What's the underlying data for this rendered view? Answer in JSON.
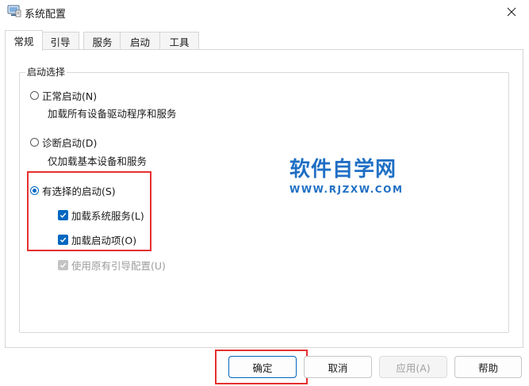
{
  "window": {
    "title": "系统配置",
    "icon": "msconfig-icon"
  },
  "tabs": [
    {
      "label": "常规",
      "active": true
    },
    {
      "label": "引导",
      "active": false
    },
    {
      "label": "服务",
      "active": false
    },
    {
      "label": "启动",
      "active": false
    },
    {
      "label": "工具",
      "active": false
    }
  ],
  "startup_group": {
    "title": "启动选择",
    "normal": {
      "label": "正常启动(N)",
      "desc": "加载所有设备驱动程序和服务",
      "selected": false
    },
    "diagnostic": {
      "label": "诊断启动(D)",
      "desc": "仅加载基本设备和服务",
      "selected": false
    },
    "selective": {
      "label": "有选择的启动(S)",
      "selected": true,
      "load_system_services": {
        "label": "加载系统服务(L)",
        "checked": true
      },
      "load_startup_items": {
        "label": "加载启动项(O)",
        "checked": true
      },
      "use_original_boot": {
        "label": "使用原有引导配置(U)",
        "checked": true,
        "disabled": true
      }
    }
  },
  "watermark": {
    "title": "软件自学网",
    "url": "WWW.RJZXW.COM"
  },
  "buttons": {
    "ok": "确定",
    "cancel": "取消",
    "apply": "应用(A)",
    "help": "帮助"
  },
  "colors": {
    "accent": "#0067c0",
    "highlight": "#e53030",
    "watermark": "#1f6fc4"
  }
}
